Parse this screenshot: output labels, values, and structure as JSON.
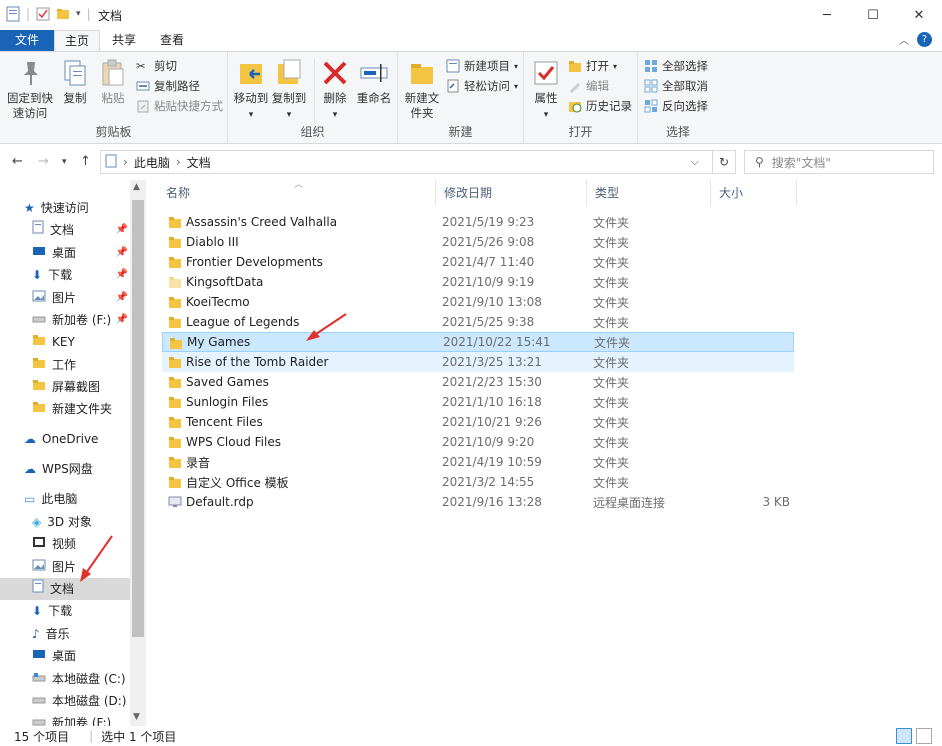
{
  "window": {
    "title": "文档",
    "controls": [
      "minimize-icon",
      "maximize-icon",
      "close-icon"
    ]
  },
  "tabs": {
    "file": "文件",
    "home": "主页",
    "share": "共享",
    "view": "查看"
  },
  "ribbon": {
    "clipboard": {
      "label": "剪贴板",
      "pin": "固定到快速访问",
      "copy": "复制",
      "paste": "粘贴",
      "cut": "剪切",
      "copy_path": "复制路径",
      "paste_shortcut": "粘贴快捷方式"
    },
    "organize": {
      "label": "组织",
      "move_to": "移动到",
      "copy_to": "复制到",
      "delete": "删除",
      "rename": "重命名"
    },
    "new": {
      "label": "新建",
      "new_folder": "新建文件夹",
      "new_item": "新建项目",
      "easy_access": "轻松访问"
    },
    "open": {
      "label": "打开",
      "properties": "属性",
      "open": "打开",
      "edit": "编辑",
      "history": "历史记录"
    },
    "select": {
      "label": "选择",
      "select_all": "全部选择",
      "select_none": "全部取消",
      "invert": "反向选择"
    }
  },
  "address": {
    "crumbs": [
      "此电脑",
      "文档"
    ],
    "search_placeholder": "搜索\"文档\""
  },
  "nav": {
    "quick_access": "快速访问",
    "quick_items": [
      "文档",
      "桌面",
      "下载",
      "图片",
      "新加卷 (F:)",
      "KEY",
      "工作",
      "屏幕截图",
      "新建文件夹"
    ],
    "onedrive": "OneDrive",
    "wps": "WPS网盘",
    "this_pc": "此电脑",
    "pc_items": [
      "3D 对象",
      "视频",
      "图片",
      "文档",
      "下载",
      "音乐",
      "桌面",
      "本地磁盘 (C:)",
      "本地磁盘 (D:)",
      "新加卷 (F:)"
    ]
  },
  "columns": {
    "name": "名称",
    "date": "修改日期",
    "type": "类型",
    "size": "大小"
  },
  "files": [
    {
      "name": "Assassin's Creed Valhalla",
      "date": "2021/5/19 9:23",
      "type": "文件夹",
      "size": ""
    },
    {
      "name": "Diablo III",
      "date": "2021/5/26 9:08",
      "type": "文件夹",
      "size": ""
    },
    {
      "name": "Frontier Developments",
      "date": "2021/4/7 11:40",
      "type": "文件夹",
      "size": ""
    },
    {
      "name": "KingsoftData",
      "date": "2021/10/9 9:19",
      "type": "文件夹",
      "size": ""
    },
    {
      "name": "KoeiTecmo",
      "date": "2021/9/10 13:08",
      "type": "文件夹",
      "size": ""
    },
    {
      "name": "League of Legends",
      "date": "2021/5/25 9:38",
      "type": "文件夹",
      "size": ""
    },
    {
      "name": "My Games",
      "date": "2021/10/22 15:41",
      "type": "文件夹",
      "size": ""
    },
    {
      "name": "Rise of the Tomb Raider",
      "date": "2021/3/25 13:21",
      "type": "文件夹",
      "size": ""
    },
    {
      "name": "Saved Games",
      "date": "2021/2/23 15:30",
      "type": "文件夹",
      "size": ""
    },
    {
      "name": "Sunlogin Files",
      "date": "2021/1/10 16:18",
      "type": "文件夹",
      "size": ""
    },
    {
      "name": "Tencent Files",
      "date": "2021/10/21 9:26",
      "type": "文件夹",
      "size": ""
    },
    {
      "name": "WPS Cloud Files",
      "date": "2021/10/9 9:20",
      "type": "文件夹",
      "size": ""
    },
    {
      "name": "录音",
      "date": "2021/4/19 10:59",
      "type": "文件夹",
      "size": ""
    },
    {
      "name": "自定义 Office 模板",
      "date": "2021/3/2 14:55",
      "type": "文件夹",
      "size": ""
    },
    {
      "name": "Default.rdp",
      "date": "2021/9/16 13:28",
      "type": "远程桌面连接",
      "size": "3 KB"
    }
  ],
  "status": {
    "count": "15 个项目",
    "selected": "选中 1 个项目"
  },
  "colors": {
    "accent": "#1a64b8",
    "selection": "#cce8ff",
    "hover": "#e5f3ff",
    "folder": "#f4c542",
    "annotation_arrow": "#e0322d"
  }
}
